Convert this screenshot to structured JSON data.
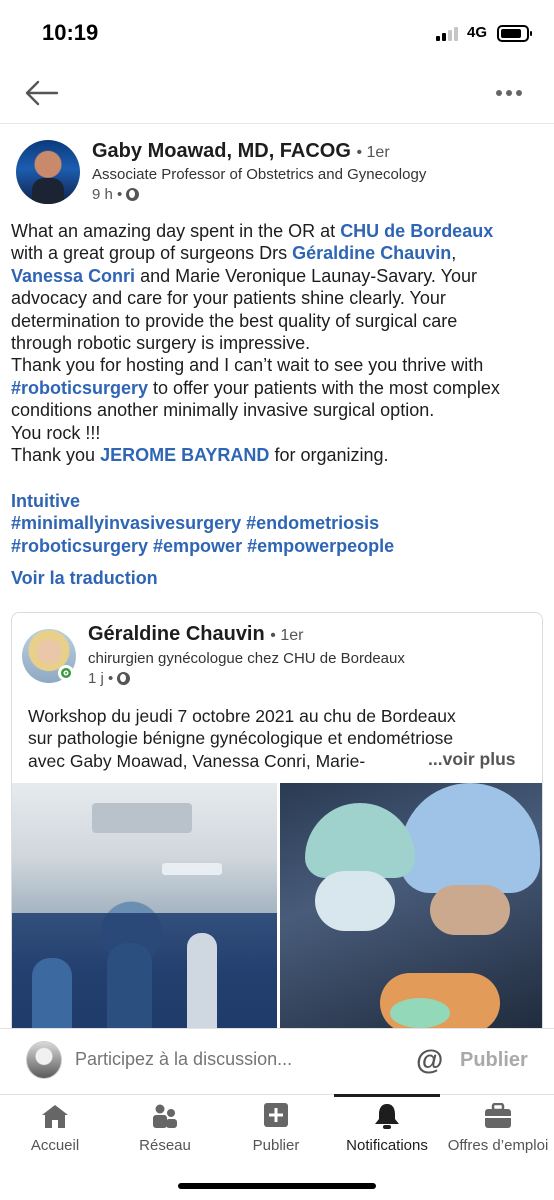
{
  "status_bar": {
    "time": "10:19",
    "network": "4G"
  },
  "author": {
    "name": "Gaby Moawad, MD, FACOG",
    "degree": "• 1er",
    "title": "Associate Professor of Obstetrics and Gynecology",
    "time": "9 h •"
  },
  "post": {
    "line1_a": "What an amazing day spent in the OR at ",
    "line1_link": "CHU de Bordeaux",
    "line2_a": "with a great group of surgeons Drs ",
    "line2_link": "Géraldine Chauvin",
    "line2_b": ",",
    "line3_link": "Vanessa Conri",
    "line3_b": " and Marie Veronique Launay-Savary. Your",
    "line4": "advocacy and care for your patients shine clearly. Your",
    "line5": "determination to provide the best quality of surgical care",
    "line6": "through robotic surgery is impressive.",
    "line7": "Thank you for hosting and I can’t wait to see you thrive with",
    "line8_link": "#roboticsurgery",
    "line8_b": " to offer your patients with the most complex",
    "line9": "conditions another minimally invasive surgical option.",
    "line10": "You rock !!!",
    "line11_a": "Thank you ",
    "line11_link": "JEROME BAYRAND",
    "line11_b": " for organizing.",
    "tags_line1": "Intuitive",
    "tags_line2": "#minimallyinvasivesurgery #endometriosis",
    "tags_line3": "#roboticsurgery #empower #empowerpeople",
    "translate": "Voir la traduction"
  },
  "shared": {
    "name": "Géraldine Chauvin",
    "degree": "• 1er",
    "title": "chirurgien gynécologue chez CHU de Bordeaux",
    "time": "1 j •",
    "body_line1": "Workshop du jeudi 7 octobre 2021 au chu de Bordeaux",
    "body_line2": "sur pathologie bénigne gynécologique et endométriose",
    "body_line3": "avec Gaby Moawad, Vanessa Conri, Marie-",
    "see_more": "...voir plus"
  },
  "comment": {
    "placeholder": "Participez à la discussion...",
    "at": "@",
    "publish": "Publier"
  },
  "tabs": [
    {
      "label": "Accueil",
      "icon": "home-icon"
    },
    {
      "label": "Réseau",
      "icon": "network-icon"
    },
    {
      "label": "Publier",
      "icon": "plus-square-icon"
    },
    {
      "label": "Notifications",
      "icon": "bell-icon",
      "active": true
    },
    {
      "label": "Offres d’emploi",
      "icon": "briefcase-icon"
    }
  ]
}
